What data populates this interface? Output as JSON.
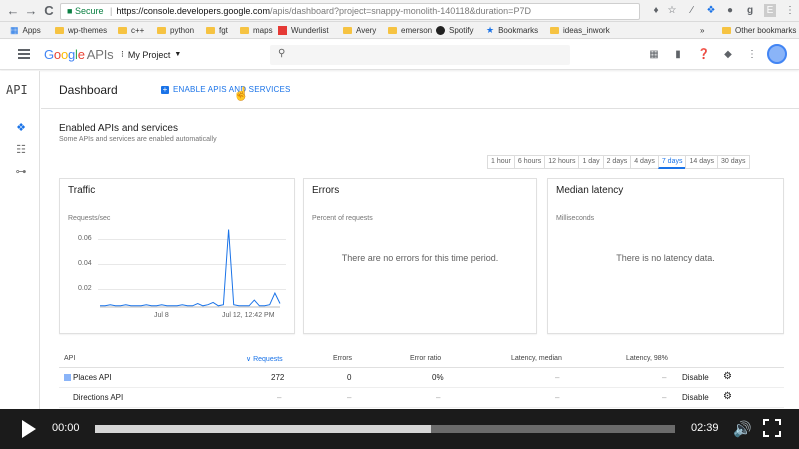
{
  "browser": {
    "back_icon": "←",
    "forward_icon": "→",
    "reload_icon": "C",
    "secure_label": "Secure",
    "url_host": "https://console.developers.google.com",
    "url_path": "/apis/dashboard?project=snappy-monolith-140118&duration=P7D",
    "extension_icons": [
      "bookmark-icon",
      "star-icon",
      "eyedropper-icon",
      "extension-icon",
      "ghost-icon",
      "evernote-icon",
      "menu-icon"
    ]
  },
  "bookmarks": {
    "items": [
      "Apps",
      "wp-themes",
      "c++",
      "python",
      "fgt",
      "maps",
      "Wunderlist",
      "Avery",
      "emerson",
      "Spotify",
      "Bookmarks",
      "ideas_inwork"
    ],
    "overflow": "»",
    "other": "Other bookmarks"
  },
  "header": {
    "logo_letters": [
      "G",
      "o",
      "o",
      "g",
      "l",
      "e"
    ],
    "logo_suffix": "APIs",
    "project_label": "My Project",
    "project_caret": "▼"
  },
  "rail": {
    "title": "API"
  },
  "subbar": {
    "title": "Dashboard",
    "enable_label": "ENABLE APIS AND SERVICES"
  },
  "section": {
    "title": "Enabled APIs and services",
    "subtitle": "Some APIs and services are enabled automatically"
  },
  "time_ranges": [
    "1 hour",
    "6 hours",
    "12 hours",
    "1 day",
    "2 days",
    "4 days",
    "7 days",
    "14 days",
    "30 days"
  ],
  "active_range": "7 days",
  "cards": {
    "traffic": {
      "title": "Traffic",
      "unit": "Requests/sec",
      "y_ticks": [
        "0.06",
        "0.04",
        "0.02"
      ],
      "x_ticks": [
        "Jul 8",
        "Jul 12, 12:42 PM"
      ]
    },
    "errors": {
      "title": "Errors",
      "unit": "Percent of requests",
      "empty": "There are no errors for this time period."
    },
    "latency": {
      "title": "Median latency",
      "unit": "Milliseconds",
      "empty": "There is no latency data."
    }
  },
  "chart_data": {
    "type": "line",
    "ylabel": "Requests/sec",
    "ylim": [
      0,
      0.07
    ],
    "x_tick_labels": [
      "Jul 8",
      "Jul 12, 12:42 PM"
    ],
    "values": [
      0.001,
      0.001,
      0.002,
      0.001,
      0.001,
      0.002,
      0.001,
      0.001,
      0.001,
      0.002,
      0.001,
      0.001,
      0.002,
      0.001,
      0.001,
      0.001,
      0.002,
      0.001,
      0.001,
      0.003,
      0.001,
      0.002,
      0.004,
      0.001,
      0.002,
      0.067,
      0.002,
      0.001,
      0.001,
      0.001,
      0.006,
      0.001,
      0.001,
      0.002,
      0.012,
      0.003
    ],
    "grid": true
  },
  "table": {
    "columns": [
      "API",
      "Requests",
      "Errors",
      "Error ratio",
      "Latency, median",
      "Latency, 98%"
    ],
    "sort_arrow": "∨",
    "rows": [
      {
        "name": "Places API",
        "requests": "272",
        "errors": "0",
        "ratio": "0%",
        "lat_median": "–",
        "lat_98": "–",
        "action": "Disable"
      },
      {
        "name": "Directions API",
        "requests": "–",
        "errors": "–",
        "ratio": "–",
        "lat_median": "–",
        "lat_98": "–",
        "action": "Disable"
      }
    ]
  },
  "player": {
    "current_time": "00:00",
    "duration": "02:39",
    "progress": 0.58
  }
}
